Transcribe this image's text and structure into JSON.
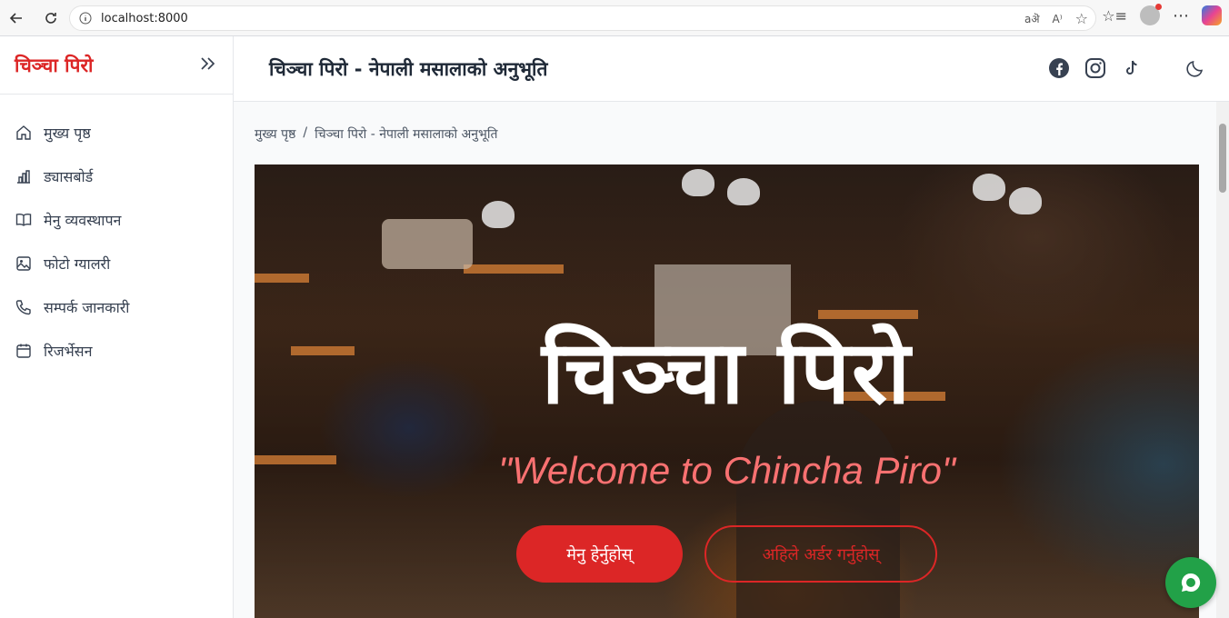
{
  "browser": {
    "url": "localhost:8000"
  },
  "sidebar": {
    "brand": "चिञ्चा पिरो",
    "items": [
      {
        "label": "मुख्य पृष्ठ",
        "icon": "home-icon"
      },
      {
        "label": "ड्यासबोर्ड",
        "icon": "chart-icon"
      },
      {
        "label": "मेनु व्यवस्थापन",
        "icon": "book-icon"
      },
      {
        "label": "फोटो ग्यालरी",
        "icon": "image-icon"
      },
      {
        "label": "सम्पर्क जानकारी",
        "icon": "phone-icon"
      },
      {
        "label": "रिजर्भेसन",
        "icon": "calendar-icon"
      }
    ]
  },
  "header": {
    "title": "चिञ्चा पिरो - नेपाली मसालाको अनुभूति",
    "social": [
      "facebook-icon",
      "instagram-icon",
      "tiktok-icon"
    ],
    "theme_icon": "moon-icon"
  },
  "breadcrumb": {
    "home": "मुख्य पृष्ठ",
    "separator": "/",
    "current": "चिञ्चा पिरो - नेपाली मसालाको अनुभूति"
  },
  "hero": {
    "title": "चिञ्चा पिरो",
    "subtitle": "\"Welcome to Chincha Piro\"",
    "primary_button": "मेनु हेर्नुहोस्",
    "secondary_button": "अहिले अर्डर गर्नुहोस्"
  },
  "colors": {
    "brand": "#dc2626",
    "chat": "#22a148"
  }
}
